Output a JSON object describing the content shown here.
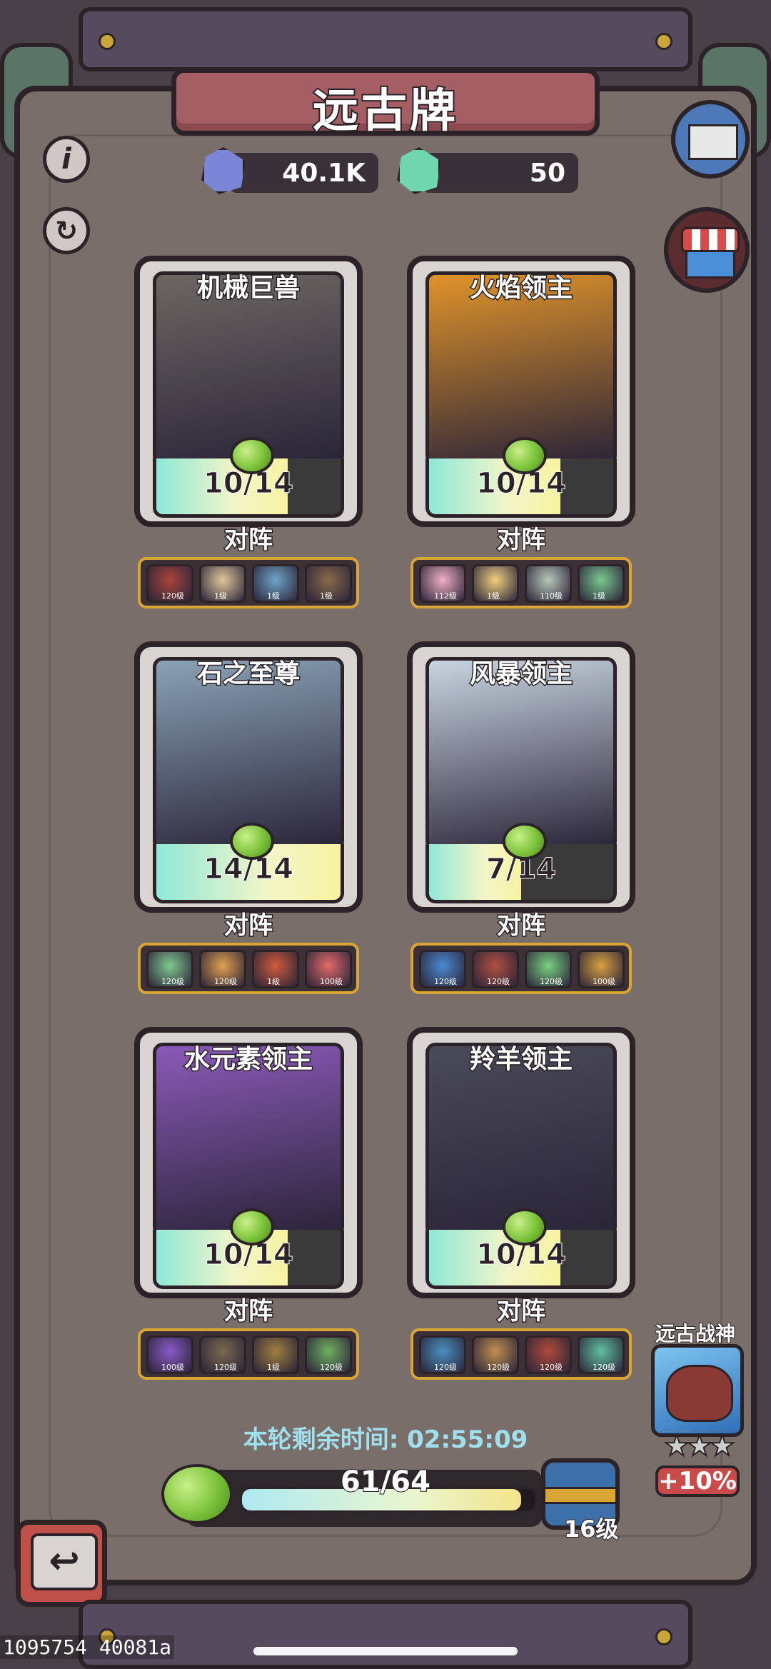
{
  "title": "远古牌",
  "currencies": [
    {
      "icon": "blue-gem-icon",
      "value": "40.1K",
      "color": "#7b86d6"
    },
    {
      "icon": "green-gem-icon",
      "value": "50",
      "color": "#6fd6b0"
    }
  ],
  "side_buttons": {
    "info": "i",
    "refresh": "↻"
  },
  "cards": [
    {
      "name": "机械巨兽",
      "progress": "10/14",
      "current": 10,
      "total": 14,
      "art_color": "#6b6762",
      "heroes": [
        {
          "lv": "120级",
          "color": "#a8443a"
        },
        {
          "lv": "1级",
          "color": "#e0c79a"
        },
        {
          "lv": "1级",
          "color": "#6fa4c8"
        },
        {
          "lv": "1级",
          "color": "#8a6a4a"
        }
      ]
    },
    {
      "name": "火焰领主",
      "progress": "10/14",
      "current": 10,
      "total": 14,
      "art_color": "#e0932a",
      "heroes": [
        {
          "lv": "112级",
          "color": "#f0b0c4"
        },
        {
          "lv": "1级",
          "color": "#f0d080"
        },
        {
          "lv": "110级",
          "color": "#b8c8b8"
        },
        {
          "lv": "1级",
          "color": "#7ac890"
        }
      ]
    },
    {
      "name": "石之至尊",
      "progress": "14/14",
      "current": 14,
      "total": 14,
      "art_color": "#8aa2b4",
      "heroes": [
        {
          "lv": "120级",
          "color": "#80c890"
        },
        {
          "lv": "120级",
          "color": "#e0a050"
        },
        {
          "lv": "1级",
          "color": "#d05a3a"
        },
        {
          "lv": "100级",
          "color": "#e06a6a"
        }
      ]
    },
    {
      "name": "风暴领主",
      "progress": "7/14",
      "current": 7,
      "total": 14,
      "art_color": "#c8d4e0",
      "heroes": [
        {
          "lv": "120级",
          "color": "#4a8ad0"
        },
        {
          "lv": "120级",
          "color": "#b05040"
        },
        {
          "lv": "120级",
          "color": "#7ad080"
        },
        {
          "lv": "100级",
          "color": "#d8a040"
        }
      ]
    },
    {
      "name": "水元素领主",
      "progress": "10/14",
      "current": 10,
      "total": 14,
      "art_color": "#8a5ab8",
      "heroes": [
        {
          "lv": "100级",
          "color": "#8a5ac8"
        },
        {
          "lv": "120级",
          "color": "#7a6a50"
        },
        {
          "lv": "1级",
          "color": "#a08040"
        },
        {
          "lv": "120级",
          "color": "#70b060"
        }
      ]
    },
    {
      "name": "羚羊领主",
      "progress": "10/14",
      "current": 10,
      "total": 14,
      "art_color": "#4a4a5a",
      "heroes": [
        {
          "lv": "120级",
          "color": "#4a90c0"
        },
        {
          "lv": "120级",
          "color": "#c09050"
        },
        {
          "lv": "120级",
          "color": "#b04a3a"
        },
        {
          "lv": "120级",
          "color": "#60c0a0"
        }
      ]
    }
  ],
  "lineup_label": "对阵",
  "timer": "本轮剩余时间: 02:55:09",
  "xp": {
    "text": "61/64",
    "current": 61,
    "total": 64
  },
  "level": "16级",
  "ancient_god": {
    "label": "远古战神",
    "stars": "★★★",
    "bonus": "+10%"
  },
  "back_icon": "↩",
  "debug_text": "1095754 40081a"
}
